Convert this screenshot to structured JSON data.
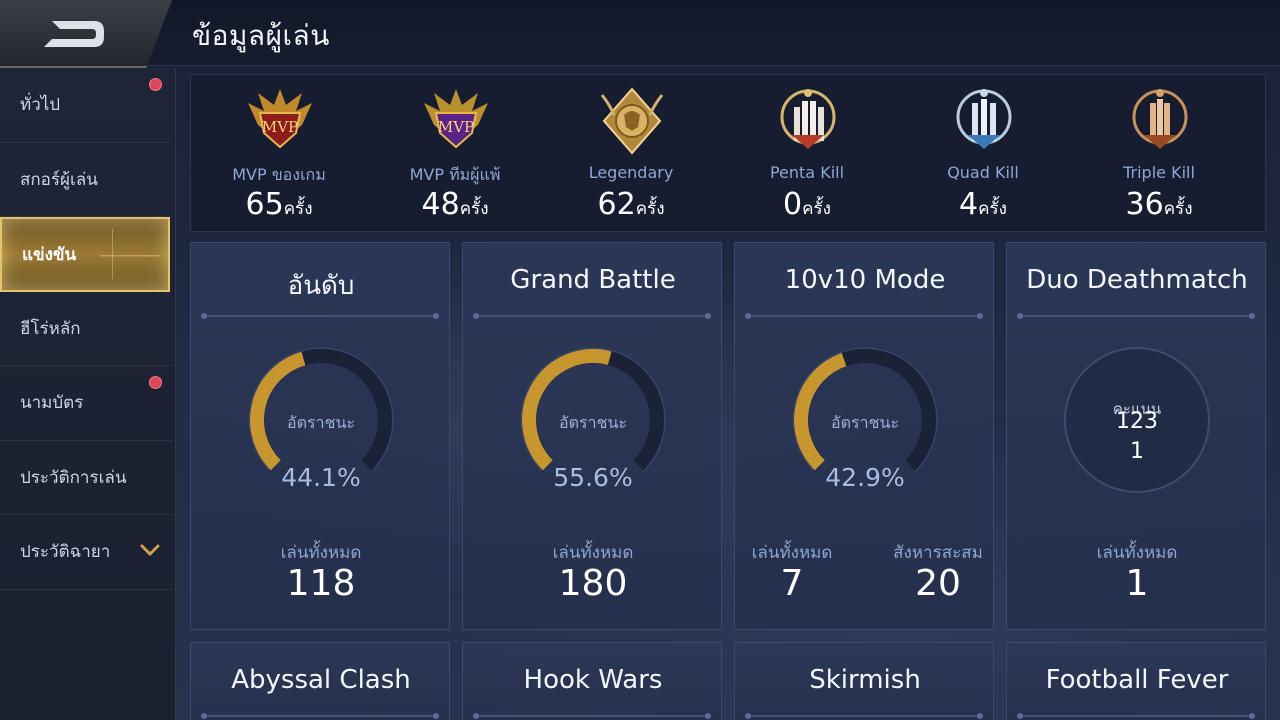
{
  "header": {
    "title": "ข้อมูลผู้เล่น",
    "back_icon": "back-arrow-icon"
  },
  "sidebar": {
    "items": [
      {
        "label": "ทั่วไป",
        "badge": true,
        "active": false
      },
      {
        "label": "สกอร์ผู้เล่น",
        "badge": false,
        "active": false
      },
      {
        "label": "แข่งขัน",
        "badge": false,
        "active": true
      },
      {
        "label": "ฮีโร่หลัก",
        "badge": false,
        "active": false
      },
      {
        "label": "นามบัตร",
        "badge": true,
        "active": false
      },
      {
        "label": "ประวัติการเล่น",
        "badge": false,
        "active": false
      },
      {
        "label": "ประวัติฉายา",
        "badge": false,
        "active": false,
        "expand_icon": "chevron-down-icon"
      }
    ]
  },
  "achievements": [
    {
      "label": "MVP ของเกม",
      "count": "65",
      "unit": "ครั้ง",
      "medal_text": "MVP",
      "icon": "mvp-gold-medal-icon"
    },
    {
      "label": "MVP ทีมผู้แพ้",
      "count": "48",
      "unit": "ครั้ง",
      "medal_text": "MVP",
      "icon": "mvp-purple-medal-icon"
    },
    {
      "label": "Legendary",
      "count": "62",
      "unit": "ครั้ง",
      "icon": "legendary-lion-medal-icon"
    },
    {
      "label": "Penta Kill",
      "count": "0",
      "unit": "ครั้ง",
      "icon": "penta-kill-medal-icon"
    },
    {
      "label": "Quad Kill",
      "count": "4",
      "unit": "ครั้ง",
      "icon": "quad-kill-medal-icon"
    },
    {
      "label": "Triple Kill",
      "count": "36",
      "unit": "ครั้ง",
      "icon": "triple-kill-medal-icon"
    }
  ],
  "modes": [
    {
      "title": "อันดับ",
      "winrate_label": "อัตราชนะ",
      "winrate": "44.1%",
      "winrate_value": 0.441,
      "total_label": "เล่นทั้งหมด",
      "total": "118"
    },
    {
      "title": "Grand Battle",
      "winrate_label": "อัตราชนะ",
      "winrate": "55.6%",
      "winrate_value": 0.556,
      "total_label": "เล่นทั้งหมด",
      "total": "180"
    },
    {
      "title": "10v10 Mode",
      "winrate_label": "อัตราชนะ",
      "winrate": "42.9%",
      "winrate_value": 0.429,
      "total_label": "เล่นทั้งหมด",
      "total": "7",
      "kills_label": "สังหารสะสม",
      "kills": "20"
    },
    {
      "title": "Duo Deathmatch",
      "score_label": "คะแนน",
      "score": "123",
      "score_sub": "1",
      "total_label": "เล่นทั้งหมด",
      "total": "1"
    }
  ],
  "more_modes": [
    "Abyssal Clash",
    "Hook Wars",
    "Skirmish",
    "Football Fever"
  ],
  "colors": {
    "gold": "#c8962e",
    "track": "#1b2238",
    "accent_active": "#e6c56a",
    "badge": "#e0465a"
  }
}
